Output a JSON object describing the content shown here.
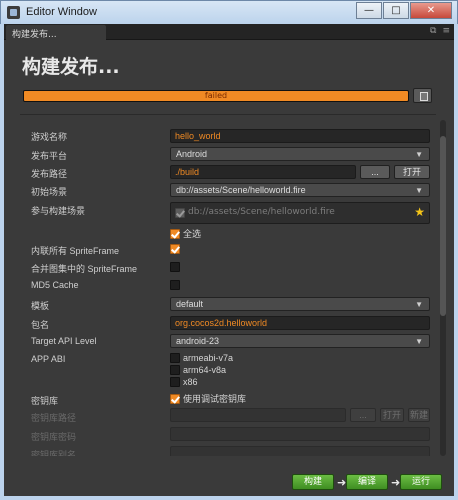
{
  "window": {
    "title": "Editor Window",
    "min_glyph": "—",
    "max_glyph": "□",
    "close_glyph": "✕"
  },
  "tab": {
    "label": "构建发布...",
    "tools": [
      "⧉",
      "≡"
    ]
  },
  "header": {
    "title": "构建发布...",
    "progress_text": "failed",
    "progress": 1.0,
    "accent": "#f08a24"
  },
  "form": {
    "game_name": {
      "label": "游戏名称",
      "value": "hello_world"
    },
    "platform": {
      "label": "发布平台",
      "value": "Android"
    },
    "build_path": {
      "label": "发布路径",
      "value": "./build",
      "browse": "...",
      "open": "打开"
    },
    "start_scene": {
      "label": "初始场景",
      "value": "db://assets/Scene/helloworld.fire"
    },
    "included_scenes": {
      "label": "参与构建场景",
      "scene": "db://assets/Scene/helloworld.fire",
      "select_all": "全选"
    },
    "inline_spriteframe": {
      "label": "内联所有 SpriteFrame",
      "checked": true
    },
    "merge_spriteframe": {
      "label": "合并图集中的 SpriteFrame",
      "checked": false
    },
    "md5_cache": {
      "label": "MD5 Cache",
      "checked": false
    },
    "template": {
      "label": "模板",
      "value": "default"
    },
    "package_name": {
      "label": "包名",
      "value": "org.cocos2d.helloworld"
    },
    "target_api": {
      "label": "Target API Level",
      "value": "android-23"
    },
    "app_abi": {
      "label": "APP ABI",
      "options": [
        {
          "label": "armeabi-v7a",
          "checked": false
        },
        {
          "label": "arm64-v8a",
          "checked": false
        },
        {
          "label": "x86",
          "checked": false
        }
      ]
    },
    "keystore": {
      "label": "密钥库",
      "option": "使用调试密钥库",
      "checked": true
    },
    "keystore_path": {
      "label": "密钥库路径",
      "browse": "...",
      "open": "打开",
      "new": "新建"
    },
    "keystore_password": {
      "label": "密钥库密码"
    },
    "keystore_alias": {
      "label": "密钥库别名"
    }
  },
  "footer": {
    "build": "构建",
    "compile": "编译",
    "run": "运行",
    "arrow": "➜"
  }
}
